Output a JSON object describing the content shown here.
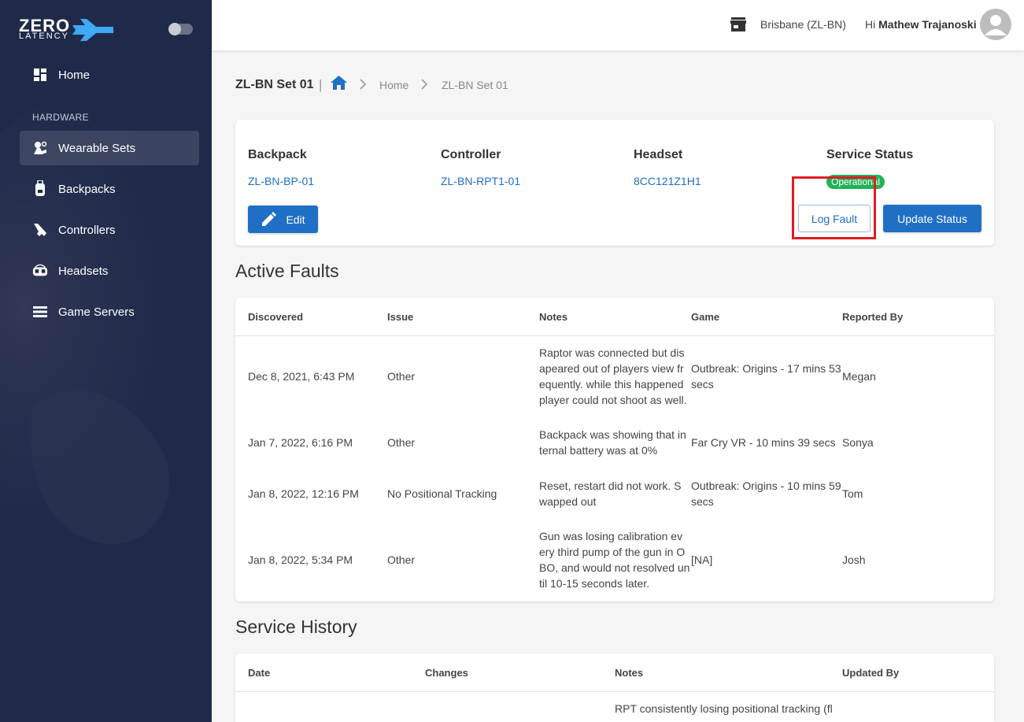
{
  "brand": {
    "line1": "ZERO",
    "line2": "LATENCY",
    "accent_color": "#3fa9f5"
  },
  "sidebar": {
    "section_label": "HARDWARE",
    "home_label": "Home",
    "items": [
      {
        "label": "Wearable Sets",
        "icon": "wearable-icon"
      },
      {
        "label": "Backpacks",
        "icon": "backpack-icon"
      },
      {
        "label": "Controllers",
        "icon": "controller-icon"
      },
      {
        "label": "Headsets",
        "icon": "headset-icon"
      },
      {
        "label": "Game Servers",
        "icon": "server-icon"
      }
    ]
  },
  "topbar": {
    "location": "Brisbane (ZL-BN)",
    "greeting_prefix": "Hi",
    "user_name": "Mathew Trajanoski"
  },
  "breadcrumb": {
    "title": "ZL-BN Set 01",
    "separator": "|",
    "home": "Home",
    "current": "ZL-BN Set 01"
  },
  "info": {
    "backpack_label": "Backpack",
    "backpack_value": "ZL-BN-BP-01",
    "controller_label": "Controller",
    "controller_value": "ZL-BN-RPT1-01",
    "headset_label": "Headset",
    "headset_value": "8CC121Z1H1",
    "status_label": "Service Status",
    "status_value": "Operational",
    "edit_label": "Edit",
    "log_fault_label": "Log Fault",
    "update_status_label": "Update Status"
  },
  "active_faults": {
    "heading": "Active Faults",
    "columns": [
      "Discovered",
      "Issue",
      "Notes",
      "Game",
      "Reported By"
    ],
    "rows": [
      {
        "discovered": "Dec 8, 2021, 6:43 PM",
        "issue": "Other",
        "notes": [
          "Raptor was connected but dis",
          "apeared out of players view fr",
          "equently. while this happened",
          "player could not shoot as well."
        ],
        "game": [
          "Outbreak: Origins - 17 mins 53",
          "secs"
        ],
        "reported_by": "Megan"
      },
      {
        "discovered": "Jan 7, 2022, 6:16 PM",
        "issue": "Other",
        "notes": [
          "Backpack was showing that in",
          "ternal battery was at 0%"
        ],
        "game": [
          "Far Cry VR - 10 mins 39 secs"
        ],
        "reported_by": "Sonya"
      },
      {
        "discovered": "Jan 8, 2022, 12:16 PM",
        "issue": "No Positional Tracking",
        "notes": [
          "Reset, restart did not work. S",
          "wapped out"
        ],
        "game": [
          "Outbreak: Origins - 10 mins 59",
          "secs"
        ],
        "reported_by": "Tom"
      },
      {
        "discovered": "Jan 8, 2022, 5:34 PM",
        "issue": "Other",
        "notes": [
          "Gun was losing calibration ev",
          "ery third pump of the gun in O",
          "BO, and would not resolved un",
          "til 10-15 seconds later."
        ],
        "game": [
          "[NA]"
        ],
        "reported_by": "Josh"
      }
    ]
  },
  "service_history": {
    "heading": "Service History",
    "columns": [
      "Date",
      "Changes",
      "Notes",
      "Updated By"
    ],
    "first_note_line": "RPT consistently losing positional tracking (fl"
  }
}
